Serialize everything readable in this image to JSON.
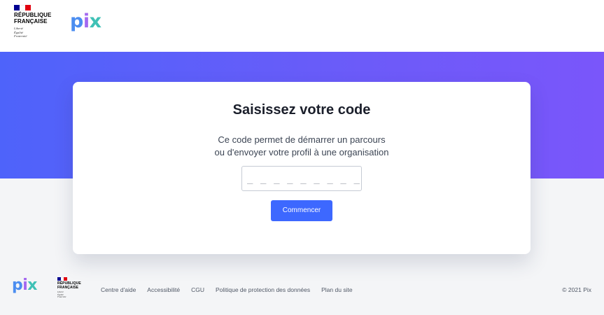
{
  "header": {
    "gov_logo": {
      "title_line1": "RÉPUBLIQUE",
      "title_line2": "FRANÇAISE",
      "motto": [
        "Liberté",
        "Égalité",
        "Fraternité"
      ]
    },
    "brand_logo": {
      "letters": [
        "p",
        "i",
        "x"
      ]
    }
  },
  "card": {
    "title": "Saisissez votre code",
    "description_line1": "Ce code permet de démarrer un parcours",
    "description_line2": "ou d'envoyer votre profil à une organisation",
    "code_input": {
      "value": "",
      "placeholder": "_ _ _ _ _ _ _ _ _"
    },
    "submit_label": "Commencer"
  },
  "footer": {
    "brand_logo": {
      "letters": [
        "p",
        "i",
        "x"
      ]
    },
    "gov_logo": {
      "title_line1": "RÉPUBLIQUE",
      "title_line2": "FRANÇAISE",
      "motto": [
        "Liberté",
        "Égalité",
        "Fraternité"
      ]
    },
    "links": [
      "Centre d'aide",
      "Accessibilité",
      "CGU",
      "Politique de protection des données",
      "Plan du site"
    ],
    "copyright": "© 2021 Pix"
  },
  "colors": {
    "banner_start": "#4e63fa",
    "banner_end": "#7a56fa",
    "button": "#3d68ff",
    "pix_p": "#4b8df0",
    "pix_i": "#a368f0",
    "pix_x": "#3fc1b6",
    "flag_blue": "#000091",
    "flag_white": "#ffffff",
    "flag_red": "#e1000f"
  }
}
